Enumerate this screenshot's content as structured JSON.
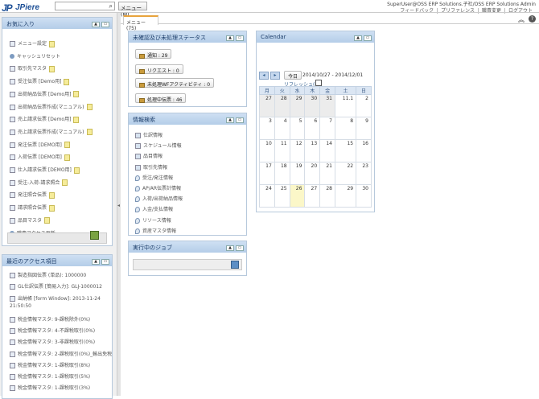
{
  "header": {
    "logo_mark": "JP",
    "logo_name": "JPiere",
    "search_icon": "search-icon",
    "menu_label": "メニュー(M)",
    "user": "SuperUser@OSS ERP Solutions.子社/OSS ERP Solutions Admin",
    "links": [
      "フィードバック",
      "プリファレンス",
      "職責変更",
      "ログアウト"
    ]
  },
  "favorites": {
    "title": "お気に入り",
    "items": [
      {
        "label": "メニュー設定",
        "icon": "document-icon"
      },
      {
        "label": "キャッシュリセット",
        "icon": "process-icon"
      },
      {
        "label": "取引先マスタ",
        "icon": "document-icon"
      },
      {
        "label": "受注伝票 [Demo用]",
        "icon": "document-icon"
      },
      {
        "label": "出荷納品伝票 [Demo用]",
        "icon": "document-icon"
      },
      {
        "label": "出荷納品伝票作成(マニュアル)",
        "icon": "document-icon"
      },
      {
        "label": "売上請求伝票 [Demo用]",
        "icon": "document-icon"
      },
      {
        "label": "売上請求伝票作成(マニュアル)",
        "icon": "document-icon"
      },
      {
        "label": "発注伝票 [DEMO用]",
        "icon": "document-icon"
      },
      {
        "label": "入荷伝票 [DEMO用]",
        "icon": "document-icon"
      },
      {
        "label": "仕入請求伝票 [DEMO用]",
        "icon": "document-icon"
      },
      {
        "label": "受注-入荷-請求照合",
        "icon": "document-icon"
      },
      {
        "label": "発注照合伝票",
        "icon": "document-icon"
      },
      {
        "label": "請求照合伝票",
        "icon": "document-icon"
      },
      {
        "label": "品目マスタ",
        "icon": "document-icon"
      },
      {
        "label": "職責アクセス更新",
        "icon": "process-icon"
      }
    ]
  },
  "recent": {
    "title": "最近のアクセス項目",
    "items": [
      "製造指図伝票 (単品): 1000000",
      "GL仕訳伝票 [簡易入力]: GLJ-1000012",
      "出納帳 [form Window]: 2013-11-24 21:50:50",
      "税金情報マスタ: 9-課税除外(0%)",
      "税金情報マスタ: 4-不課税取引(0%)",
      "税金情報マスタ: 3-非課税取引(0%)",
      "税金情報マスタ: 2-課税取引(0%)_輸出免税",
      "税金情報マスタ: 1-課税取引(8%)",
      "税金情報マスタ: 1-課税取引(5%)",
      "税金情報マスタ: 1-課税取引(3%)"
    ]
  },
  "tab": {
    "label": "メニュー (75)"
  },
  "status_panel": {
    "title": "未確認及び未処理ステータス",
    "buttons": [
      "通知 : 29",
      "リクエスト : 0",
      "未処理WFアクティビティ : 0",
      "処理中伝票 : 46"
    ]
  },
  "info_panel": {
    "title": "情報検索",
    "items": [
      {
        "label": "仕訳情報",
        "icon": "chart-icon"
      },
      {
        "label": "スケジュール情報",
        "icon": "clock-icon"
      },
      {
        "label": "品目情報",
        "icon": "box-icon"
      },
      {
        "label": "取引先情報",
        "icon": "person-icon"
      },
      {
        "label": "受注/発注情報",
        "icon": "pin-icon"
      },
      {
        "label": "AP/AR伝票計情報",
        "icon": "pin-icon"
      },
      {
        "label": "入荷/出荷納品情報",
        "icon": "pin-icon"
      },
      {
        "label": "入金/支払情報",
        "icon": "pin-icon"
      },
      {
        "label": "リソース情報",
        "icon": "pin-icon"
      },
      {
        "label": "資産マスタ情報",
        "icon": "pin-icon"
      }
    ]
  },
  "jobs_panel": {
    "title": "実行中のジョブ"
  },
  "calendar": {
    "title": "Calendar",
    "today_label": "今日",
    "range": "2014/10/27 - 2014/12/01",
    "refresh_label": "リフレッシュ(Q)",
    "weekdays": [
      "月",
      "火",
      "水",
      "木",
      "金",
      "土",
      "日"
    ],
    "weeks": [
      [
        "27",
        "28",
        "29",
        "30",
        "31",
        "11.1",
        "2"
      ],
      [
        "3",
        "4",
        "5",
        "6",
        "7",
        "8",
        "9"
      ],
      [
        "10",
        "11",
        "12",
        "13",
        "14",
        "15",
        "16"
      ],
      [
        "17",
        "18",
        "19",
        "20",
        "21",
        "22",
        "23"
      ],
      [
        "24",
        "25",
        "26",
        "27",
        "28",
        "29",
        "30"
      ]
    ],
    "today_cell": [
      4,
      2
    ]
  },
  "colors": {
    "panel_header": "#b4cde8",
    "accent_tab": "#e8a33c",
    "today": "#fbf7c8"
  }
}
